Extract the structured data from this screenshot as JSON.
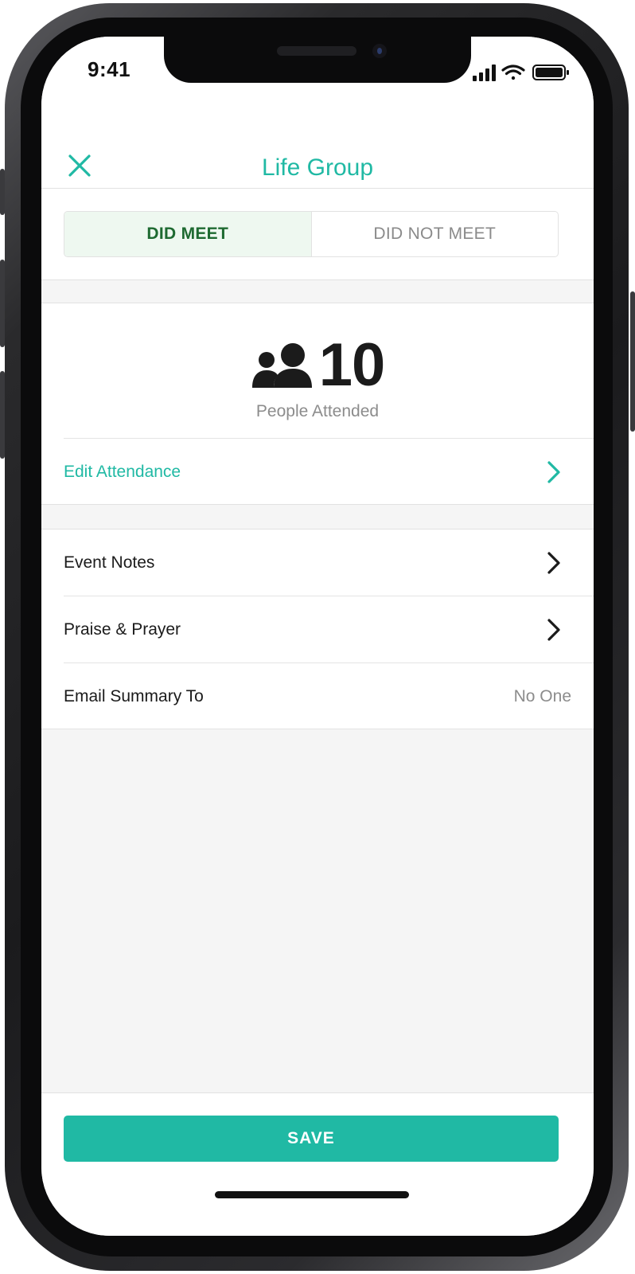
{
  "status_bar": {
    "time": "9:41",
    "icons": [
      "cellular-signal-icon",
      "wifi-icon",
      "battery-icon"
    ]
  },
  "nav": {
    "title": "Life Group",
    "close_icon": "close-icon"
  },
  "meeting_toggle": {
    "options": [
      "DID MEET",
      "DID NOT MEET"
    ],
    "selected": "DID MEET"
  },
  "attendance": {
    "count": "10",
    "label": "People Attended",
    "icon": "people-icon",
    "edit_label": "Edit Attendance"
  },
  "menu": [
    {
      "label": "Event Notes"
    },
    {
      "label": "Praise & Prayer"
    },
    {
      "label": "Email Summary To",
      "value": "No One"
    }
  ],
  "footer": {
    "save_label": "SAVE"
  },
  "colors": {
    "accent": "#20b9a4",
    "selected_text": "#1e6a31",
    "selected_bg": "#eef8f0",
    "muted_text": "#8c8c8c"
  }
}
